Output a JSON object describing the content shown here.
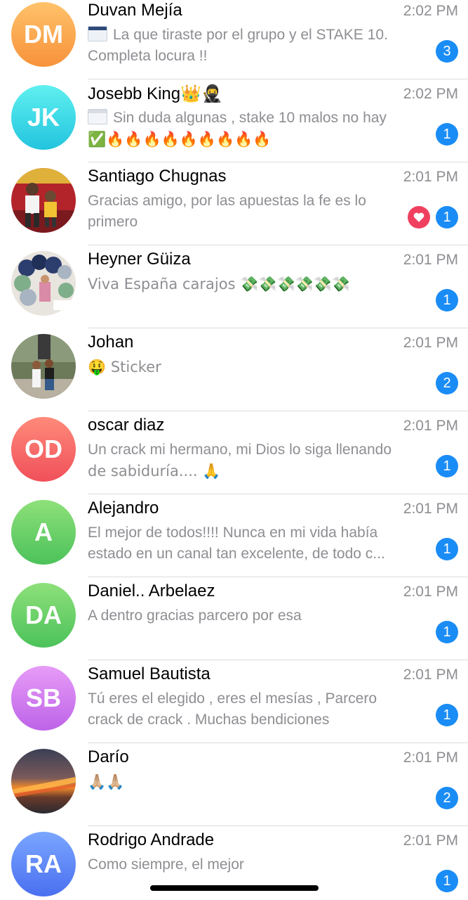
{
  "chats": [
    {
      "name": "Duvan Mejía",
      "time": "2:02 PM",
      "initials": "DM",
      "avatar_color_top": "#ffc26b",
      "avatar_color_bottom": "#f7923a",
      "preview_lines": [
        "La que tiraste por el grupo y el STAKE 10.",
        "Completa locura !!"
      ],
      "unread": "3"
    },
    {
      "name": "Josebb King👑🥷",
      "time": "2:02 PM",
      "initials": "JK",
      "avatar_color_top": "#5ff0f0",
      "avatar_color_bottom": "#23c4de",
      "preview_lines": [
        "Sin duda algunas , stake 10 malos no hay",
        "✅🔥🔥🔥🔥🔥🔥🔥🔥🔥"
      ],
      "unread": "1"
    },
    {
      "name": "Santiago Chugnas",
      "time": "2:01 PM",
      "preview_lines": [
        "Gracias amigo, por las apuestas la fe es lo",
        "primero"
      ],
      "unread": "1",
      "reaction_icon": "heart-icon"
    },
    {
      "name": "Heyner Güiza",
      "time": "2:01 PM",
      "preview_lines": [
        "Viva España carajos 💸💸💸💸💸💸"
      ],
      "unread": "1"
    },
    {
      "name": "Johan",
      "time": "2:01 PM",
      "preview_lines": [
        "🤑 Sticker"
      ],
      "unread": "2"
    },
    {
      "name": "oscar diaz",
      "time": "2:01 PM",
      "initials": "OD",
      "avatar_color_top": "#ff8a7a",
      "avatar_color_bottom": "#f0505a",
      "preview_lines": [
        "Un crack mi hermano, mi Dios lo siga llenando",
        "de sabiduría.... 🙏"
      ],
      "unread": "1"
    },
    {
      "name": "Alejandro",
      "time": "2:01 PM",
      "initials": "A",
      "avatar_color_top": "#8ee07a",
      "avatar_color_bottom": "#4cc25a",
      "preview_lines": [
        "El mejor de todos!!!! Nunca en mi vida había",
        "estado en un canal tan excelente, de todo c..."
      ],
      "unread": "1"
    },
    {
      "name": "Daniel.. Arbelaez",
      "time": "2:01 PM",
      "initials": "DA",
      "avatar_color_top": "#8ee07a",
      "avatar_color_bottom": "#4cc25a",
      "preview_lines": [
        "A dentro gracias parcero por esa"
      ],
      "unread": "1"
    },
    {
      "name": "Samuel Bautista",
      "time": "2:01 PM",
      "initials": "SB",
      "avatar_color_top": "#e79cf7",
      "avatar_color_bottom": "#bd63e8",
      "preview_lines": [
        "Tú eres el elegido , eres el mesías , Parcero",
        "crack de crack . Muchas bendiciones"
      ],
      "unread": "1"
    },
    {
      "name": "Darío",
      "time": "2:01 PM",
      "preview_lines": [
        "🙏🏼🙏🏼"
      ],
      "unread": "2"
    },
    {
      "name": "Rodrigo Andrade",
      "time": "2:01 PM",
      "initials": "RA",
      "avatar_color_top": "#7aa6ff",
      "avatar_color_bottom": "#4a6ff0",
      "preview_lines": [
        "Como siempre, el mejor"
      ],
      "unread": "1"
    }
  ],
  "colors": {
    "badge_blue": "#1a8cf5",
    "reaction_red": "#f0405f",
    "secondary_text": "#8e8e93",
    "divider": "#dcdce0"
  }
}
